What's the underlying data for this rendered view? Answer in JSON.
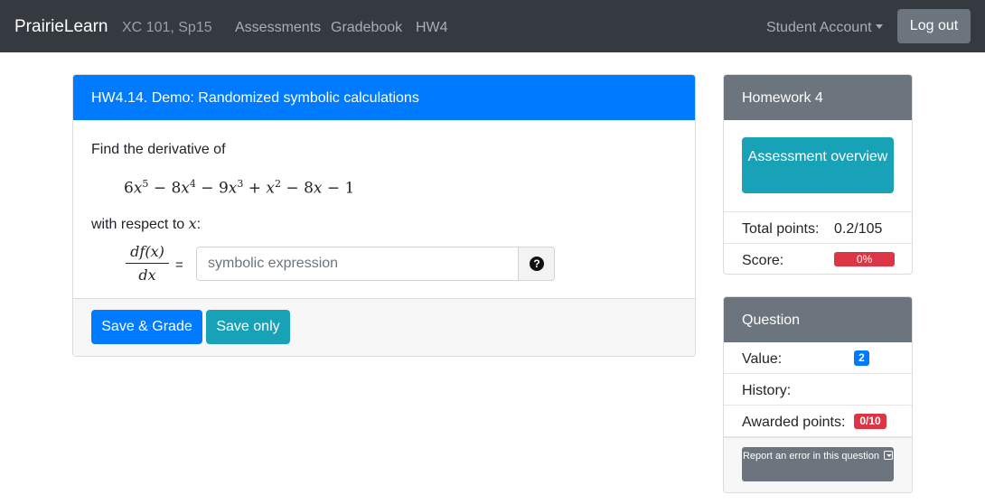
{
  "navbar": {
    "brand": "PrairieLearn",
    "course": "XC 101, Sp15",
    "links": [
      "Assessments",
      "Gradebook",
      "HW4"
    ],
    "account": "Student Account",
    "logout": "Log out"
  },
  "question": {
    "title": "HW4.14. Demo: Randomized symbolic calculations",
    "prompt": "Find the derivative of",
    "respect_prefix": "with respect to",
    "respect_var": "x",
    "respect_suffix": ":",
    "frac_num": "df(x)",
    "frac_den": "dx",
    "equals": "=",
    "input_placeholder": "symbolic expression",
    "help_icon": "question-circle-icon",
    "save_grade": "Save & Grade",
    "save_only": "Save only"
  },
  "assessment_card": {
    "title": "Homework 4",
    "overview_button": "Assessment overview",
    "total_points_label": "Total points:",
    "total_points_value": "0.2/105",
    "score_label": "Score:",
    "score_value": "0%",
    "score_fraction": 0
  },
  "question_card": {
    "title": "Question",
    "value_label": "Value:",
    "value_badge": "2",
    "history_label": "History:",
    "awarded_label": "Awarded points:",
    "awarded_badge": "0/10",
    "report_label": "Report an error in this question"
  },
  "colors": {
    "navbar": "#343a40",
    "primary": "#007bff",
    "info": "#17a2b8",
    "secondary": "#6c757d",
    "danger": "#dc3545"
  }
}
